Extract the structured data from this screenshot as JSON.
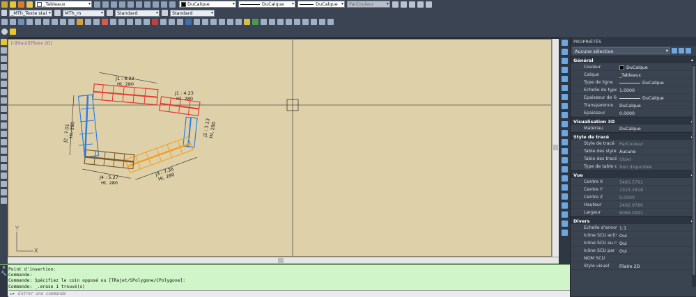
{
  "toolbar1": {
    "layer_combo": "_Tableaux",
    "color_combo": "DuCalque",
    "linetype_combo": "DuCalque",
    "lineweight_combo": "DuCalque",
    "plotstyle_combo": "ParCouleur"
  },
  "toolbar2": {
    "textstyle_combo": "_MTh_Texte stai",
    "dimstyle_combo": "MTh_m",
    "tablestyle_combo": "Standard",
    "mleaderstyle_combo": "Standard"
  },
  "viewport": {
    "label": "[-][Haut][Filaire 2D]"
  },
  "drawing": {
    "labels": {
      "j1_len": "J1 : 6.22",
      "j1_ht": "Ht. 280",
      "j1b_len": "J1 : 4.23",
      "j1b_ht": "Ht. 280",
      "j2_len": "J2 : 7.01",
      "j2_ht": "Ht. 280",
      "j2b_len": "J2 : 3.13",
      "j2b_ht": "Ht. 280",
      "j3_len": "J3 : 7.36",
      "j3_ht": "Ht. 280",
      "j4_len": "J4 : 5.27",
      "j4_ht": "Ht. 280"
    },
    "ucs_y": "Y",
    "ucs_x": "X"
  },
  "properties": {
    "title": "PROPRIÉTÉS",
    "selection": "Aucune sélection",
    "sections": {
      "general": "Général",
      "vis3d": "Visualisation 3D",
      "plotstyle": "Style de tracé",
      "view": "Vue",
      "misc": "Divers"
    },
    "general": [
      {
        "name": "Couleur",
        "value": "DuCalque"
      },
      {
        "name": "Calque",
        "value": "_Tableaux"
      },
      {
        "name": "Type de ligne",
        "value": "DuCalque"
      },
      {
        "name": "Echelle du type de li...",
        "value": "1.0000"
      },
      {
        "name": "Epaisseur de ligne",
        "value": "DuCalque"
      },
      {
        "name": "Transparence",
        "value": "DuCalque"
      },
      {
        "name": "Epaisseur",
        "value": "0.0000"
      }
    ],
    "vis3d": [
      {
        "name": "Matériau",
        "value": "DuCalque"
      }
    ],
    "plotstyle": [
      {
        "name": "Style de tracé",
        "value": "ParCouleur"
      },
      {
        "name": "Table des styles de tr...",
        "value": "Aucune"
      },
      {
        "name": "Table des tracés atta...",
        "value": "Objet"
      },
      {
        "name": "Type de table de tracé",
        "value": "Non disponible"
      }
    ],
    "view": [
      {
        "name": "Centre X",
        "value": "5483.5791"
      },
      {
        "name": "Centre Y",
        "value": "1315.3418"
      },
      {
        "name": "Centre Z",
        "value": "0.0000"
      },
      {
        "name": "Hauteur",
        "value": "2462.9780"
      },
      {
        "name": "Largeur",
        "value": "6089.0291"
      }
    ],
    "misc": [
      {
        "name": "Echelle d'annotation",
        "value": "1:1"
      },
      {
        "name": "Icône SCU active",
        "value": "Oui"
      },
      {
        "name": "Icône SCU au niveau...",
        "value": "Oui"
      },
      {
        "name": "Icône SCU par fenêtre",
        "value": "Oui"
      },
      {
        "name": "NOM SCU",
        "value": ""
      },
      {
        "name": "Style visuel",
        "value": "Filaire 2D"
      }
    ]
  },
  "command": {
    "line1": "Point d'insertion:",
    "line2": "Commande:",
    "line3": "Commande: Spécifiez le coin opposé ou [TRajet/SPolygone/CPolygone]:",
    "line4": "Commande: _.erase 1 trouvé(s)",
    "placeholder": "Entrer une commande"
  }
}
